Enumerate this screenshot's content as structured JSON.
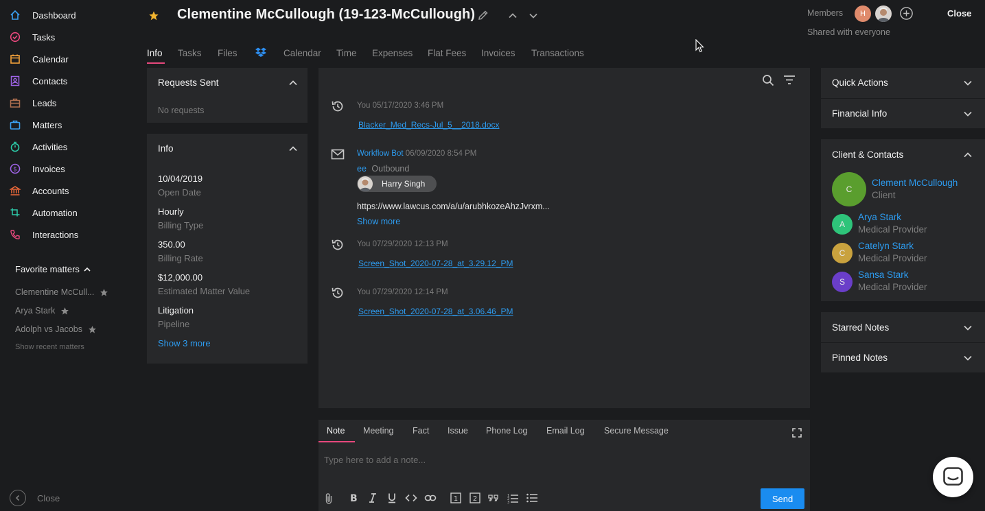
{
  "sidebar": {
    "items": [
      {
        "label": "Dashboard",
        "icon": "home-icon",
        "color": "#3aa0f0"
      },
      {
        "label": "Tasks",
        "icon": "check-circle-icon",
        "color": "#e8487d"
      },
      {
        "label": "Calendar",
        "icon": "calendar-icon",
        "color": "#f2a03a"
      },
      {
        "label": "Contacts",
        "icon": "contact-card-icon",
        "color": "#a064e8"
      },
      {
        "label": "Leads",
        "icon": "briefcase-icon",
        "color": "#b07050"
      },
      {
        "label": "Matters",
        "icon": "case-icon",
        "color": "#3aa0f0"
      },
      {
        "label": "Activities",
        "icon": "timer-icon",
        "color": "#2ccaa8"
      },
      {
        "label": "Invoices",
        "icon": "dollar-icon",
        "color": "#a064e8"
      },
      {
        "label": "Accounts",
        "icon": "bank-icon",
        "color": "#f06a3a"
      },
      {
        "label": "Automation",
        "icon": "automation-icon",
        "color": "#2ccaa8"
      },
      {
        "label": "Interactions",
        "icon": "phone-icon",
        "color": "#e8487d"
      }
    ],
    "favorites_title": "Favorite matters",
    "favorites": [
      "Clementine McCull...",
      "Arya Stark",
      "Adolph vs Jacobs"
    ],
    "show_recent": "Show recent matters",
    "close": "Close"
  },
  "header": {
    "title": "Clementine McCullough (19-123-McCullough)",
    "members_label": "Members",
    "member_initial": "H",
    "shared": "Shared with everyone",
    "close": "Close"
  },
  "tabs": [
    "Info",
    "Tasks",
    "Files",
    "Calendar",
    "Time",
    "Expenses",
    "Flat Fees",
    "Invoices",
    "Transactions"
  ],
  "requests": {
    "title": "Requests Sent",
    "empty": "No requests"
  },
  "info": {
    "title": "Info",
    "fields": [
      {
        "value": "10/04/2019",
        "label": "Open Date"
      },
      {
        "value": "Hourly",
        "label": "Billing Type"
      },
      {
        "value": "350.00",
        "label": "Billing Rate"
      },
      {
        "value": "$12,000.00",
        "label": "Estimated Matter Value"
      },
      {
        "value": "Litigation",
        "label": "Pipeline"
      }
    ],
    "show_more": "Show 3 more"
  },
  "feed": {
    "entries": [
      {
        "meta": "You 05/17/2020 3:46 PM",
        "link": "Blacker_Med_Recs-Jul_5__2018.docx"
      },
      {
        "meta": "You 07/29/2020 12:13 PM",
        "link": "Screen_Shot_2020-07-28_at_3.29.12_PM"
      },
      {
        "meta": "You 07/29/2020 12:14 PM",
        "link": "Screen_Shot_2020-07-28_at_3.06.46_PM"
      }
    ],
    "email": {
      "sender": "Workflow Bot",
      "date": "06/09/2020 8:54 PM",
      "subject": "ee",
      "direction": "Outbound",
      "recipient": "Harry Singh",
      "body": "https://www.lawcus.com/a/u/arubhkozeAhzJvrxm...",
      "show_more": "Show more"
    }
  },
  "composer": {
    "tabs": [
      "Note",
      "Meeting",
      "Fact",
      "Issue",
      "Phone Log",
      "Email Log",
      "Secure Message"
    ],
    "placeholder": "Type here to add a note...",
    "send": "Send"
  },
  "right": {
    "quick_actions": "Quick Actions",
    "financial_info": "Financial Info",
    "client_contacts": "Client & Contacts",
    "contacts": [
      {
        "initial": "C",
        "name": "Clement McCullough",
        "role": "Client",
        "color": "#5a9e2e"
      },
      {
        "initial": "A",
        "name": "Arya Stark",
        "role": "Medical Provider",
        "color": "#2ec47a"
      },
      {
        "initial": "C",
        "name": "Catelyn Stark",
        "role": "Medical Provider",
        "color": "#c9a23e"
      },
      {
        "initial": "S",
        "name": "Sansa Stark",
        "role": "Medical Provider",
        "color": "#6a3ec9"
      }
    ],
    "starred_notes": "Starred Notes",
    "pinned_notes": "Pinned Notes"
  }
}
